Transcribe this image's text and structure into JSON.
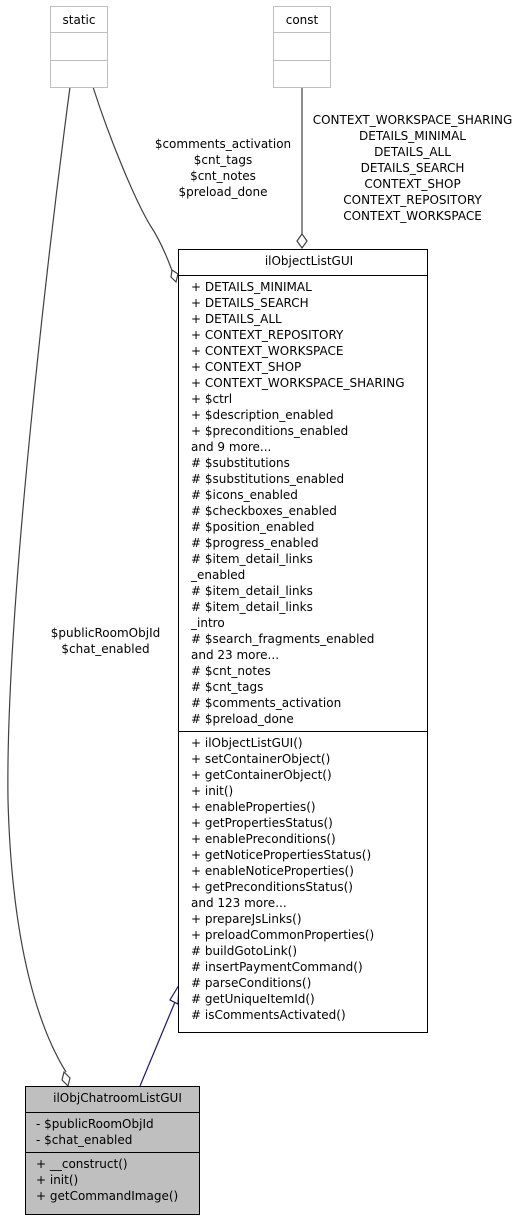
{
  "classes": {
    "static": {
      "name": "static"
    },
    "const": {
      "name": "const"
    },
    "parent": {
      "name": "ilObjectListGUI",
      "attributes": [
        "+ DETAILS_MINIMAL",
        "+ DETAILS_SEARCH",
        "+ DETAILS_ALL",
        "+ CONTEXT_REPOSITORY",
        "+ CONTEXT_WORKSPACE",
        "+ CONTEXT_SHOP",
        "+ CONTEXT_WORKSPACE_SHARING",
        "+ $ctrl",
        "+ $description_enabled",
        "+ $preconditions_enabled",
        "and 9 more...",
        "# $substitutions",
        "# $substitutions_enabled",
        "# $icons_enabled",
        "# $checkboxes_enabled",
        "# $position_enabled",
        "# $progress_enabled",
        "# $item_detail_links",
        "_enabled",
        "# $item_detail_links",
        "# $item_detail_links",
        "_intro",
        "# $search_fragments_enabled",
        "and 23 more...",
        "# $cnt_notes",
        "# $cnt_tags",
        "# $comments_activation",
        "# $preload_done"
      ],
      "methods": [
        "+ ilObjectListGUI()",
        "+ setContainerObject()",
        "+ getContainerObject()",
        "+ init()",
        "+ enableProperties()",
        "+ getPropertiesStatus()",
        "+ enablePreconditions()",
        "+ getNoticePropertiesStatus()",
        "+ enableNoticeProperties()",
        "+ getPreconditionsStatus()",
        "and 123 more...",
        "+ prepareJsLinks()",
        "+ preloadCommonProperties()",
        "# buildGotoLink()",
        "# insertPaymentCommand()",
        "# parseConditions()",
        "# getUniqueItemId()",
        "# isCommentsActivated()"
      ]
    },
    "child": {
      "name": "ilObjChatroomListGUI",
      "attributes": [
        "- $publicRoomObjId",
        "- $chat_enabled"
      ],
      "methods": [
        "+ __construct()",
        "+ init()",
        "+ getCommandImage()"
      ]
    }
  },
  "edges": {
    "static_to_parent": [
      "$comments_activation",
      "$cnt_tags",
      "$cnt_notes",
      "$preload_done"
    ],
    "const_to_parent": [
      "CONTEXT_WORKSPACE_SHARING",
      "DETAILS_MINIMAL",
      "DETAILS_ALL",
      "DETAILS_SEARCH",
      "CONTEXT_SHOP",
      "CONTEXT_REPOSITORY",
      "CONTEXT_WORKSPACE"
    ],
    "static_to_child": [
      "$publicRoomObjId",
      "$chat_enabled"
    ]
  },
  "colors": {
    "inheritance_edge": "#191970",
    "usage_edge": "#404040",
    "child_fill": "#bfbfbf",
    "external_border": "#bfbfbf"
  }
}
